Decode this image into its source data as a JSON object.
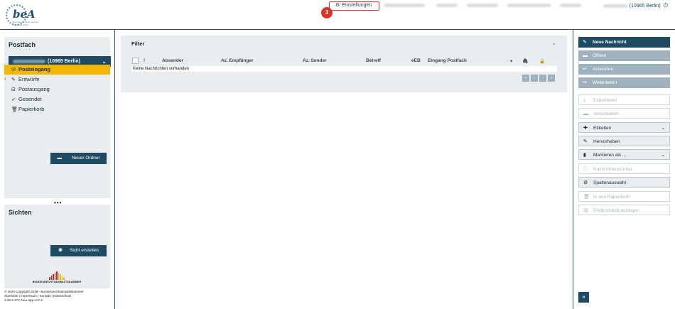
{
  "header": {
    "logo_text": "beA",
    "logo_subtitle": "Besonderes elektronisches Anwaltspostfach",
    "step_badge": "3",
    "settings_label": "Einstellungen",
    "user_location": "(10965 Berlin)",
    "icons": {
      "settings": "gear-icon",
      "logout": "power-icon"
    }
  },
  "postfach": {
    "title": "Postfach",
    "mailbox_label": "(10965 Berlin)",
    "folders": [
      {
        "label": "Posteingang",
        "icon": "inbox-icon",
        "active": true
      },
      {
        "label": "Entwürfe",
        "icon": "edit-icon",
        "active": false,
        "expandable": true
      },
      {
        "label": "Postausgang",
        "icon": "outbox-icon",
        "active": false
      },
      {
        "label": "Gesendet",
        "icon": "send-icon",
        "active": false
      },
      {
        "label": "Papierkorb",
        "icon": "trash-icon",
        "active": false
      }
    ],
    "new_folder_label": "Neuer Ordner"
  },
  "sichten": {
    "title": "Sichten",
    "create_label": "Sicht erstellen"
  },
  "footer": {
    "org_name": "BUNDESRECHTSANWALTSKAMMER",
    "copyright": "© 2024 Copyright 2018 - Bundesrechtsanwaltskammer",
    "links": "Startseite | Impressum | Kontakt | Datenschutz",
    "version": "3.28.2.373, bea-app-cc2-2"
  },
  "filter": {
    "title": "Filter",
    "columns": {
      "priority": "!",
      "absender": "Absender",
      "empfaenger": "Az. Empfänger",
      "sender": "Az. Sender",
      "betreff": "Betreff",
      "eeb": "eEB",
      "eingang": "Eingang Postfach"
    },
    "empty_text": "Keine Nachrichten vorhanden",
    "pager": [
      "«",
      "‹",
      "›",
      "»"
    ]
  },
  "actions": [
    {
      "label": "Neue Nachricht",
      "icon": "pencil-icon",
      "style": "primary"
    },
    {
      "label": "Öffnen",
      "icon": "open-icon",
      "style": "grey"
    },
    {
      "label": "Antworten",
      "icon": "reply-icon",
      "style": "grey"
    },
    {
      "label": "Weiterleiten",
      "icon": "forward-icon",
      "style": "grey"
    },
    {
      "label": "Exportieren",
      "icon": "download-icon",
      "style": "disabled"
    },
    {
      "label": "Verschieben",
      "icon": "folder-icon",
      "style": "disabled"
    },
    {
      "label": "Etiketten",
      "icon": "tag-icon",
      "style": "outline",
      "dropdown": true
    },
    {
      "label": "Hervorheben",
      "icon": "highlight-icon",
      "style": "outline"
    },
    {
      "label": "Markieren als ...",
      "icon": "bookmark-icon",
      "style": "outline",
      "dropdown": true
    },
    {
      "label": "Nachrichtenjournal",
      "icon": "info-icon",
      "style": "disabled"
    },
    {
      "label": "Spaltenauswahl",
      "icon": "gear-icon",
      "style": "outline"
    },
    {
      "label": "In den Papierkorb",
      "icon": "trash-icon",
      "style": "disabled"
    },
    {
      "label": "Prüfprotokoll anzeigen",
      "icon": "document-icon",
      "style": "disabled"
    }
  ],
  "expand_label": "»",
  "colors": {
    "primary": "#1f4a63",
    "accent_active": "#f2b705",
    "panel_bg": "#e9edef",
    "highlight_red": "#d8352a"
  }
}
